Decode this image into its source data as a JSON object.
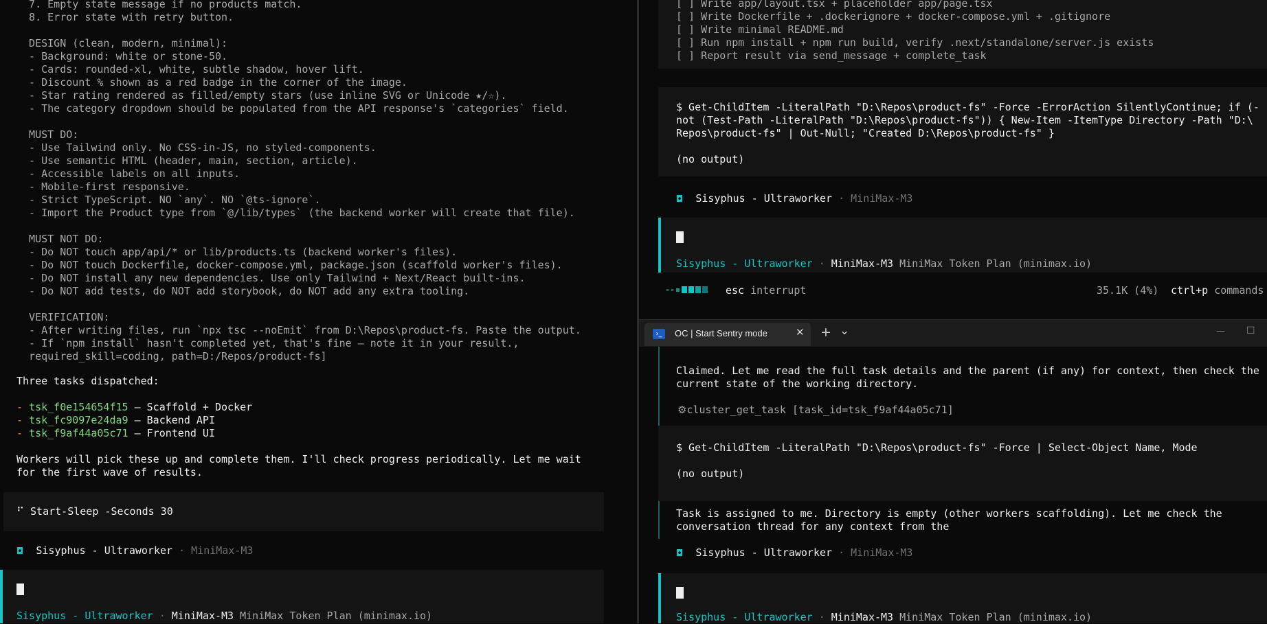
{
  "left_pane": {
    "lines": [
      "  7. Empty state message if no products match.",
      "  8. Error state with retry button.",
      "",
      "  DESIGN (clean, modern, minimal):",
      "  - Background: white or stone-50.",
      "  - Cards: rounded-xl, white, subtle shadow, hover lift.",
      "  - Discount % shown as a red badge in the corner of the image.",
      "  - Star rating rendered as filled/empty stars (use inline SVG or Unicode ★/☆).",
      "  - The category dropdown should be populated from the API response's `categories` field.",
      "",
      "  MUST DO:",
      "  - Use Tailwind only. No CSS-in-JS, no styled-components.",
      "  - Use semantic HTML (header, main, section, article).",
      "  - Accessible labels on all inputs.",
      "  - Mobile-first responsive.",
      "  - Strict TypeScript. NO `any`. NO `@ts-ignore`.",
      "  - Import the Product type from `@/lib/types` (the backend worker will create that file).",
      "",
      "  MUST NOT DO:",
      "  - Do NOT touch app/api/* or lib/products.ts (backend worker's files).",
      "  - Do NOT touch Dockerfile, docker-compose.yml, package.json (scaffold worker's files).",
      "  - Do NOT install any new dependencies. Use only Tailwind + Next/React built-ins.",
      "  - Do NOT add tests, do NOT add storybook, do NOT add any extra tooling.",
      "",
      "  VERIFICATION:",
      "  - After writing files, run `npx tsc --noEmit` from D:\\Repos\\product-fs. Paste the output.",
      "  - If `npm install` hasn't completed yet, that's fine — note it in your result.,",
      "  required_skill=coding, path=D:/Repos/product-fs]"
    ],
    "dispatched_heading": "Three tasks dispatched:",
    "tasks": [
      {
        "id": "tsk_f0e154654f15",
        "desc": " — Scaffold + Docker"
      },
      {
        "id": "tsk_fc9097e24da9",
        "desc": " — Backend API"
      },
      {
        "id": "tsk_f9af44a05c71",
        "desc": " — Frontend UI"
      }
    ],
    "bullet": "- ",
    "workers_line1": "Workers will pick these up and complete them. I'll check progress periodically. Let me wait",
    "workers_line2": "for the first wave of results.",
    "sleep_glyph": "⠋",
    "sleep_cmd": "Start-Sleep -Seconds 30",
    "agent_icon": "◘",
    "agent_name": "Sisyphus - Ultraworker",
    "sep": " · ",
    "model": "MiniMax-M3",
    "plan": "MiniMax Token Plan (minimax.io)"
  },
  "right_top": {
    "lines": [
      "[ ] Write app/layout.tsx + placeholder app/page.tsx",
      "[ ] Write Dockerfile + .dockerignore + docker-compose.yml + .gitignore",
      "[ ] Write minimal README.md",
      "[ ] Run npm install + npm run build, verify .next/standalone/server.js exists",
      "[ ] Report result via send_message + complete_task"
    ],
    "cmd_lines": [
      "$ Get-ChildItem -LiteralPath \"D:\\Repos\\product-fs\" -Force -ErrorAction SilentlyContinue; if (-",
      "not (Test-Path -LiteralPath \"D:\\Repos\\product-fs\")) { New-Item -ItemType Directory -Path \"D:\\",
      "Repos\\product-fs\" | Out-Null; \"Created D:\\Repos\\product-fs\" }"
    ],
    "no_output": "(no output)",
    "agent_icon": "◘",
    "agent_name": "Sisyphus - Ultraworker",
    "sep": " · ",
    "model": "MiniMax-M3",
    "plan": "MiniMax Token Plan (minimax.io)",
    "esc_key": "esc",
    "esc_label": " interrupt",
    "tokens": "35.1K (4%)",
    "cmd_key": "ctrl+p",
    "cmd_label": " commands"
  },
  "tab": {
    "title": "OC | Start Sentry mode",
    "close": "✕",
    "new_tab": "+",
    "dropdown": "⌄",
    "minimize": "—",
    "maximize": "☐",
    "ps_icon": "›_"
  },
  "right_bottom": {
    "claimed_line1": "Claimed. Let me read the full task details and the parent (if any) for context, then check the",
    "claimed_line2": "current state of the working directory.",
    "tool_icon": "⚙",
    "tool_call": "cluster_get_task [task_id=tsk_f9af44a05c71]",
    "cmd": "$ Get-ChildItem -LiteralPath \"D:\\Repos\\product-fs\" -Force | Select-Object Name, Mode",
    "no_output": "(no output)",
    "assigned_line1": "Task is assigned to me. Directory is empty (other workers scaffolding). Let me check the",
    "assigned_line2": "conversation thread for any context from the",
    "agent_icon": "◘",
    "agent_name": "Sisyphus - Ultraworker",
    "sep": " · ",
    "model": "MiniMax-M3",
    "plan": "MiniMax Token Plan (minimax.io)"
  }
}
